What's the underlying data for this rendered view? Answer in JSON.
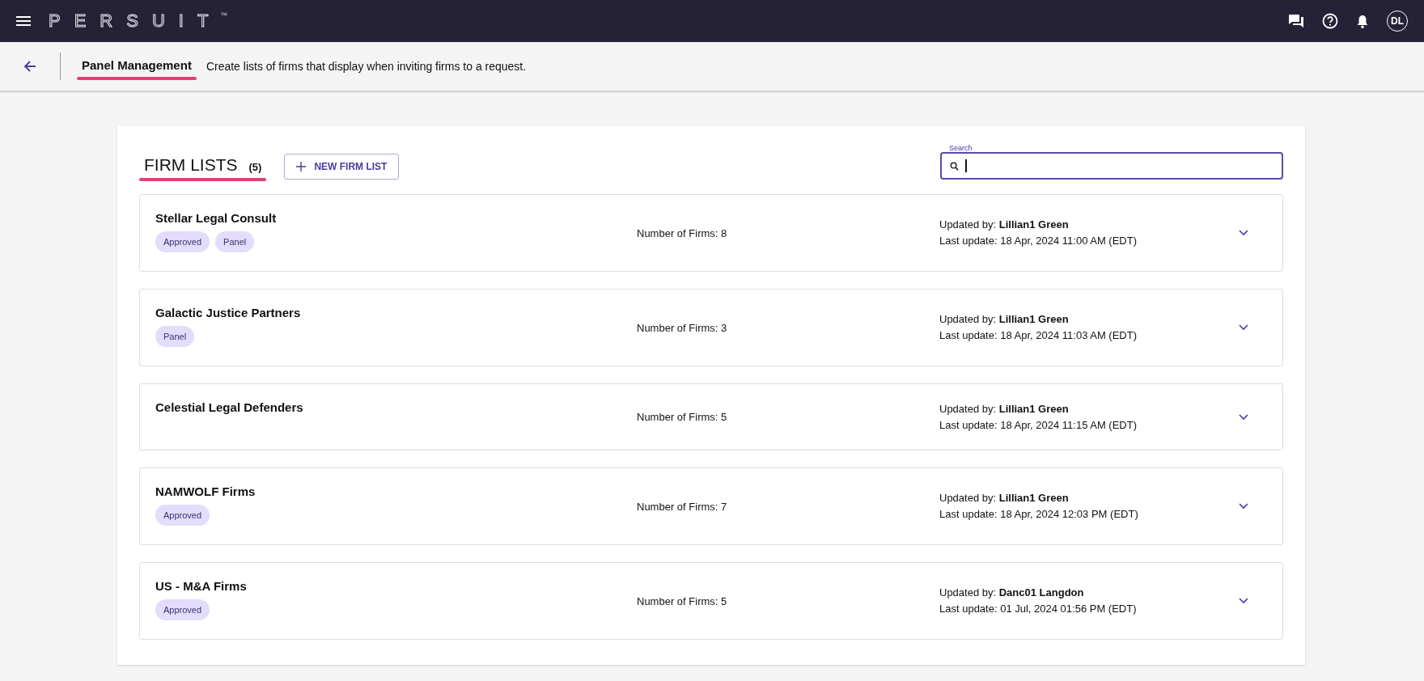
{
  "app_bar": {
    "logo": "PERSUIT",
    "trademark": "™",
    "avatar": "DL"
  },
  "page_header": {
    "title": "Panel Management",
    "description": "Create lists of firms that display when inviting firms to a request."
  },
  "firm_lists": {
    "title": "FIRM LISTS",
    "count": "(5)",
    "new_button": "NEW FIRM LIST",
    "search": {
      "label": "Search"
    },
    "items": [
      {
        "name": "Stellar Legal Consult",
        "tags": [
          "Approved",
          "Panel"
        ],
        "firms": "Number of Firms: 8",
        "updated_by": "Updated by: **Lillian1 Green**",
        "last_update": "Last update: 18 Apr, 2024 11:00 AM (EDT)",
        "expanded": false
      },
      {
        "name": "Galactic Justice Partners",
        "tags": [
          "Panel"
        ],
        "firms": "Number of Firms: 3",
        "updated_by": "Updated by: **Lillian1 Green**",
        "last_update": "Last update: 18 Apr, 2024 11:03 AM (EDT)",
        "expanded": false
      },
      {
        "name": "Celestial Legal Defenders",
        "firms": "Number of Firms: 5",
        "updated_by": "Updated by: **Lillian1 Green**",
        "last_update": "Last update: 18 Apr, 2024 11:15 AM (EDT)",
        "expanded": false
      },
      {
        "name": "NAMWOLF Firms",
        "tags": [
          "Approved"
        ],
        "firms": "Number of Firms: 7",
        "updated_by": "Updated by: **Lillian1 Green**",
        "last_update": "Last update: 18 Apr, 2024 12:03 PM (EDT)",
        "expanded": false
      },
      {
        "name": "US - M&A Firms",
        "tags": [
          "Approved"
        ],
        "firms": "Number of Firms: 5",
        "updated_by": "Updated by: **Danc01 Langdon**",
        "last_update": "Last update: 01 Jul, 2024 01:56 PM (EDT)",
        "expanded": false
      }
    ]
  }
}
